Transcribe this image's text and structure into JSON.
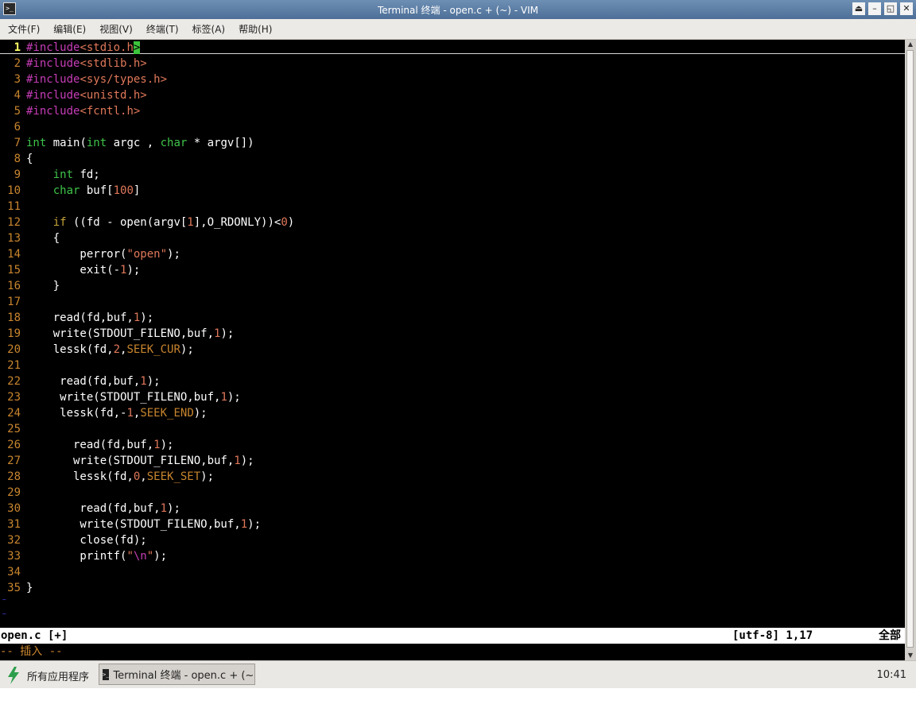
{
  "window": {
    "title": "Terminal 终端 - open.c + (~) - VIM",
    "icon": "terminal-icon",
    "controls": [
      "⏏",
      "–",
      "◱",
      "✕"
    ]
  },
  "menu": [
    "文件(F)",
    "编辑(E)",
    "视图(V)",
    "终端(T)",
    "标签(A)",
    "帮助(H)"
  ],
  "editor": {
    "lines": [
      [
        [
          "pp",
          "#include"
        ],
        [
          "str",
          "<stdio.h"
        ],
        [
          "cursor",
          ">"
        ]
      ],
      [
        [
          "pp",
          "#include"
        ],
        [
          "str",
          "<stdlib.h>"
        ]
      ],
      [
        [
          "pp",
          "#include"
        ],
        [
          "str",
          "<sys/types.h>"
        ]
      ],
      [
        [
          "pp",
          "#include"
        ],
        [
          "str",
          "<unistd.h>"
        ]
      ],
      [
        [
          "pp",
          "#include"
        ],
        [
          "str",
          "<fcntl.h>"
        ]
      ],
      [],
      [
        [
          "ty",
          "int"
        ],
        [
          "t",
          " main("
        ],
        [
          "ty",
          "int"
        ],
        [
          "t",
          " argc , "
        ],
        [
          "ty",
          "char"
        ],
        [
          "t",
          " * argv[])"
        ]
      ],
      [
        [
          "t",
          "{"
        ]
      ],
      [
        [
          "t",
          "    "
        ],
        [
          "ty",
          "int"
        ],
        [
          "t",
          " fd;"
        ]
      ],
      [
        [
          "t",
          "    "
        ],
        [
          "ty",
          "char"
        ],
        [
          "t",
          " buf["
        ],
        [
          "num",
          "100"
        ],
        [
          "t",
          "]"
        ]
      ],
      [],
      [
        [
          "t",
          "    "
        ],
        [
          "kw",
          "if"
        ],
        [
          "t",
          " ((fd - open(argv["
        ],
        [
          "num",
          "1"
        ],
        [
          "t",
          "],O_RDONLY))<"
        ],
        [
          "num",
          "0"
        ],
        [
          "t",
          ")"
        ]
      ],
      [
        [
          "t",
          "    {"
        ]
      ],
      [
        [
          "t",
          "        perror("
        ],
        [
          "str",
          "\"open\""
        ],
        [
          "t",
          ");"
        ]
      ],
      [
        [
          "t",
          "        exit(-"
        ],
        [
          "num",
          "1"
        ],
        [
          "t",
          ");"
        ]
      ],
      [
        [
          "t",
          "    }"
        ]
      ],
      [],
      [
        [
          "t",
          "    read(fd,buf,"
        ],
        [
          "num",
          "1"
        ],
        [
          "t",
          ");"
        ]
      ],
      [
        [
          "t",
          "    write(STDOUT_FILENO,buf,"
        ],
        [
          "num",
          "1"
        ],
        [
          "t",
          ");"
        ]
      ],
      [
        [
          "t",
          "    lessk(fd,"
        ],
        [
          "num",
          "2"
        ],
        [
          "t",
          ","
        ],
        [
          "const",
          "SEEK_CUR"
        ],
        [
          "t",
          ");"
        ]
      ],
      [],
      [
        [
          "t",
          "     read(fd,buf,"
        ],
        [
          "num",
          "1"
        ],
        [
          "t",
          ");"
        ]
      ],
      [
        [
          "t",
          "     write(STDOUT_FILENO,buf,"
        ],
        [
          "num",
          "1"
        ],
        [
          "t",
          ");"
        ]
      ],
      [
        [
          "t",
          "     lessk(fd,-"
        ],
        [
          "num",
          "1"
        ],
        [
          "t",
          ","
        ],
        [
          "const",
          "SEEK_END"
        ],
        [
          "t",
          ");"
        ]
      ],
      [],
      [
        [
          "t",
          "       read(fd,buf,"
        ],
        [
          "num",
          "1"
        ],
        [
          "t",
          ");"
        ]
      ],
      [
        [
          "t",
          "       write(STDOUT_FILENO,buf,"
        ],
        [
          "num",
          "1"
        ],
        [
          "t",
          ");"
        ]
      ],
      [
        [
          "t",
          "       lessk(fd,"
        ],
        [
          "num",
          "0"
        ],
        [
          "t",
          ","
        ],
        [
          "const",
          "SEEK_SET"
        ],
        [
          "t",
          ");"
        ]
      ],
      [],
      [
        [
          "t",
          "        read(fd,buf,"
        ],
        [
          "num",
          "1"
        ],
        [
          "t",
          ");"
        ]
      ],
      [
        [
          "t",
          "        write(STDOUT_FILENO,buf,"
        ],
        [
          "num",
          "1"
        ],
        [
          "t",
          ");"
        ]
      ],
      [
        [
          "t",
          "        close(fd);"
        ]
      ],
      [
        [
          "t",
          "        printf("
        ],
        [
          "str",
          "\""
        ],
        [
          "pp",
          "\\n"
        ],
        [
          "str",
          "\""
        ],
        [
          "t",
          ");"
        ]
      ],
      [],
      [
        [
          "t",
          "}"
        ]
      ]
    ],
    "current_line": 1,
    "empty_line_markers": [
      "~",
      "~"
    ]
  },
  "statusline": {
    "filename": "open.c [+]",
    "encoding_position": "[utf-8] 1,17",
    "scroll": "全部"
  },
  "cmdline": "-- 插入 --",
  "taskbar": {
    "start_label": "所有应用程序",
    "task_label": "Terminal 终端 - open.c + (~…",
    "clock": "10:41"
  },
  "colors": {
    "editor_bg": "#000000",
    "line_number": "#c8852e",
    "preprocessor": "#c63db7",
    "type": "#3fc34a",
    "constant": "#e0785a",
    "cursor": "#3cc43c"
  }
}
